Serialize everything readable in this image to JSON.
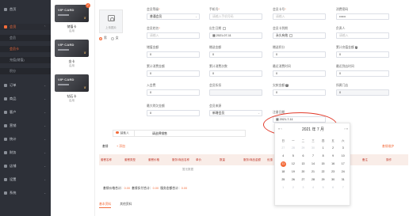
{
  "sidebar": {
    "items": [
      {
        "label": "首页"
      },
      {
        "label": "会员"
      },
      {
        "label": "订单"
      },
      {
        "label": "商品"
      },
      {
        "label": "客户"
      },
      {
        "label": "营销"
      },
      {
        "label": "统计"
      },
      {
        "label": "财务"
      },
      {
        "label": "店铺"
      },
      {
        "label": "设置"
      },
      {
        "label": "系统"
      }
    ],
    "subitems": [
      {
        "label": "会员"
      },
      {
        "label": "会员卡"
      },
      {
        "label": "充值(储值)"
      },
      {
        "label": "积分"
      }
    ]
  },
  "cards": [
    {
      "card_text": "VIP CARD",
      "name": "储值卡",
      "status": "启用"
    },
    {
      "card_text": "VIP CARD",
      "name": "金卡",
      "status": "启用"
    },
    {
      "card_text": "VIP CARD",
      "name": "钻石卡",
      "status": "启用"
    }
  ],
  "form": {
    "upload_label": "上传图片",
    "gender_options": [
      "男",
      "女"
    ],
    "fields": {
      "member_level": {
        "label": "会员等级",
        "value": "普通会员"
      },
      "phone": {
        "label": "手机号",
        "placeholder": "请输入手机号码"
      },
      "card_no": {
        "label": "会员卡号",
        "placeholder": "请输入"
      },
      "password": {
        "label": "消费密码",
        "value": "••••••"
      },
      "name": {
        "label": "会员姓名",
        "placeholder": "请输入"
      },
      "birthday": {
        "label": "出生日期",
        "value": "2021-07-11"
      },
      "expire": {
        "label": "会员卡到期",
        "value": "永久有效"
      },
      "recorder": {
        "label": "负责人",
        "placeholder": "请输入"
      },
      "balance": {
        "label": "储值金额",
        "value": "0"
      },
      "gift_amount": {
        "label": "赠送金额",
        "value": "0"
      },
      "points": {
        "label": "赠送积分",
        "value": "0"
      },
      "cumulative": {
        "label": "累计充值金额",
        "value": "0"
      },
      "a1": {
        "label": "累计消费金额",
        "value": "0"
      },
      "a2": {
        "label": "累计消费次数",
        "value": "0"
      },
      "a3": {
        "label": "最近消费时间",
        "value": "0"
      },
      "a4": {
        "label": "最近到店时间",
        "value": "0"
      },
      "deposit": {
        "label": "入会费",
        "value": "0"
      },
      "discount": {
        "label": "会员折扣",
        "value": ""
      },
      "debt": {
        "label": "欠款金额",
        "value": "0"
      },
      "store": {
        "label": "所属门店",
        "value": "0"
      },
      "recharge_total": {
        "label": "最大赊欠金额",
        "value": "0"
      },
      "source": {
        "label": "会员来源",
        "value": "新增会员"
      },
      "register_date": {
        "label": "注册日期",
        "value": "2021-7-11"
      }
    },
    "sales": {
      "label": "销售人",
      "value": "请选择销售"
    }
  },
  "section": {
    "title": "套餐",
    "add": "+ 添加",
    "right_link": "套餐维护",
    "headers": [
      "套餐名称",
      "套餐类型",
      "套餐价格",
      "服务/商品名称",
      "单价",
      "数量",
      "服务/商品金额",
      "优惠",
      "实付",
      "有效期",
      "余次",
      "备注",
      "操作"
    ],
    "empty": "暂无数据",
    "totals_a": "套餐价格合计：",
    "totals_a_val": "0.00",
    "totals_b": "套餐实付合计：",
    "totals_b_val": "0.00",
    "totals_c": "服务金额合计：",
    "totals_c_val": "0.00"
  },
  "tabs": [
    {
      "label": "基本资料"
    },
    {
      "label": "其他资料"
    }
  ],
  "datepicker": {
    "title": "2021 年 7 月",
    "prev": "« ‹",
    "next": "› »",
    "weekdays": [
      "日",
      "一",
      "二",
      "三",
      "四",
      "五",
      "六"
    ],
    "days": [
      [
        27,
        28,
        29,
        30,
        1,
        2,
        3
      ],
      [
        4,
        5,
        6,
        7,
        8,
        9,
        10
      ],
      [
        11,
        12,
        13,
        14,
        15,
        16,
        17
      ],
      [
        18,
        19,
        20,
        21,
        22,
        23,
        24
      ],
      [
        25,
        26,
        27,
        28,
        29,
        30,
        31
      ],
      [
        1,
        2,
        3,
        4,
        5,
        6,
        7
      ]
    ],
    "selected": 11,
    "accent": "#f36c3b"
  }
}
